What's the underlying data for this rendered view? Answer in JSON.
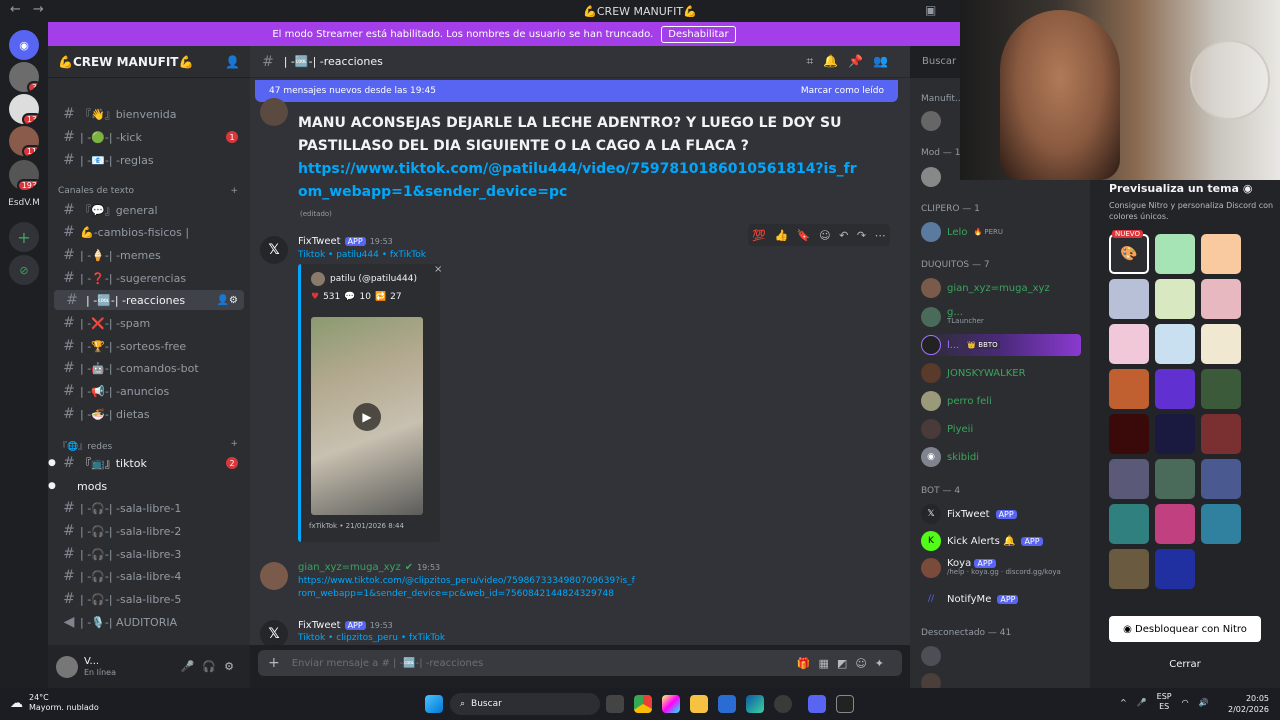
{
  "window": {
    "title": "💪CREW MANUFIT💪"
  },
  "streamer_banner": {
    "text": "El modo Streamer está habilitado. Los nombres de usuario se han truncado.",
    "button": "Deshabilitar"
  },
  "servers": [
    {
      "label": "",
      "badge": "3"
    },
    {
      "label": "",
      "badge": "13"
    },
    {
      "label": "",
      "badge": "11"
    },
    {
      "label": "",
      "badge": "193"
    }
  ],
  "server_name_label": "EsdV.M",
  "guild": {
    "name": "💪CREW MANUFIT💪"
  },
  "sidebar": {
    "top_channels": [
      {
        "label": "『👋』bienvenida",
        "badge": ""
      },
      {
        "label": "| -🟢-| -kick",
        "badge": "1"
      },
      {
        "label": "| -📧-| -reglas",
        "badge": ""
      }
    ],
    "category_text": "Canales de texto",
    "text_channels": [
      {
        "label": "『💬』general",
        "badge": ""
      },
      {
        "label": "💪-cambios-fisicos |",
        "badge": ""
      },
      {
        "label": "| -🍦-| -memes",
        "badge": ""
      },
      {
        "label": "| -❓-| -sugerencias",
        "badge": ""
      },
      {
        "label": "| -🆒-| -reacciones",
        "badge": ""
      },
      {
        "label": "| -❌-| -spam",
        "badge": ""
      },
      {
        "label": "| -🏆-| -sorteos-free",
        "badge": ""
      },
      {
        "label": "| -🤖-| -comandos-bot",
        "badge": ""
      },
      {
        "label": "| -📢-| -anuncios",
        "badge": ""
      },
      {
        "label": "| -🍜-| dietas",
        "badge": ""
      }
    ],
    "category_redes": "『🌐』redes",
    "redes_channels": [
      {
        "label": "『📺』tiktok",
        "badge": "2"
      },
      {
        "label": "mods",
        "badge": ""
      }
    ],
    "voice_channels": [
      {
        "label": "| -🎧-| -sala-libre-1"
      },
      {
        "label": "| -🎧-| -sala-libre-2"
      },
      {
        "label": "| -🎧-| -sala-libre-3"
      },
      {
        "label": "| -🎧-| -sala-libre-4"
      },
      {
        "label": "| -🎧-| -sala-libre-5"
      },
      {
        "label": "| -🎙️-| AUDITORIA"
      }
    ]
  },
  "user": {
    "name": "V...",
    "status": "En línea"
  },
  "channel_header": {
    "name": "| -🆒-| -reacciones"
  },
  "search_placeholder": "Buscar",
  "new_messages": {
    "text": "47 mensajes nuevos desde las 19:45",
    "mark": "Marcar como leído"
  },
  "messages": {
    "m1": {
      "text": "MANU ACONSEJAS DEJARLE LA LECHE ADENTRO?  Y LUEGO LE DOY SU PASTILLASO DEL DIA SIGUIENTE O LA CAGO A LA FLACA ?",
      "link": "https://www.tiktok.com/@patilu444/video/7597810186010561814?is_from_webapp=1&sender_device=pc",
      "edited": "(editado)"
    },
    "m2": {
      "author": "FixTweet",
      "app": "APP",
      "time": "19:53",
      "links": "Tiktok • patilu444 • fxTikTok",
      "embed_user": "patilu (@patilu444)",
      "stats": {
        "likes": "531",
        "comments": "10",
        "shares": "27"
      },
      "footer": "fxTikTok • 21/01/2026 8:44"
    },
    "m3": {
      "author": "gian_xyz=muga_xyz",
      "time": "19:53",
      "link": "https://www.tiktok.com/@clipzitos_peru/video/7598673334980709639?is_from_webapp=1&sender_device=pc&web_id=7560842144824329748"
    },
    "m4": {
      "author": "FixTweet",
      "app": "APP",
      "time": "19:53",
      "links": "Tiktok • clipzitos_peru • fxTikTok"
    }
  },
  "composer": {
    "placeholder": "Enviar mensaje a # | -🆒-| -reacciones"
  },
  "members": {
    "cat_manufit": "Manufit...",
    "cat_mod": "Mod — 1",
    "cat_clipero": "CLIPERO — 1",
    "cat_duquitos": "DUQUITOS — 7",
    "cat_bot": "BOT — 4",
    "cat_offline": "Desconectado — 41",
    "list": [
      {
        "name": "Lelo",
        "tag": "🔥 PERU",
        "color": "#3ba55d"
      },
      {
        "name": "gian_xyz=muga_xyz",
        "tag": "",
        "color": "#3ba55d"
      },
      {
        "name": "g...",
        "tag": "TLauncher",
        "color": "#3ba55d"
      },
      {
        "name": "l...",
        "tag": "👑 BBTO",
        "color": "#a570ff"
      },
      {
        "name": "JONSKYWALKER",
        "tag": "",
        "color": "#3ba55d"
      },
      {
        "name": "perro feli",
        "tag": "",
        "color": "#3ba55d"
      },
      {
        "name": "Piyeii",
        "tag": "",
        "color": "#3ba55d"
      },
      {
        "name": "skibidi",
        "tag": "",
        "color": "#3ba55d"
      }
    ],
    "bots": [
      {
        "name": "FixTweet",
        "app": "APP",
        "sub": ""
      },
      {
        "name": "Kick Alerts 🔔",
        "app": "APP",
        "sub": ""
      },
      {
        "name": "Koya",
        "app": "APP",
        "sub": "/help · koya.gg · discord.gg/koya"
      },
      {
        "name": "NotifyMe",
        "app": "APP",
        "sub": ""
      }
    ]
  },
  "theme_panel": {
    "title": "Previsualiza un tema",
    "desc": "Consigue Nitro y personaliza Discord con colores únicos.",
    "new_tag": "NUEVO",
    "unlock": "Desbloquear con Nitro",
    "close": "Cerrar",
    "swatches": [
      "#2b2d31",
      "#a6e3b5",
      "#f9c9a0",
      "#b8c0d8",
      "#d8e8c0",
      "#e8b8c0",
      "#f0c8d8",
      "#c8e0f0",
      "#f0e8d0",
      "#c06030",
      "#6030d0",
      "#3a5a3a",
      "#3a0a0a",
      "#1a1a40",
      "#7a3030",
      "#5a5a78",
      "#4a6a5a",
      "#4a5a90",
      "#308080",
      "#c04080",
      "#3080a0",
      "#6a5a40",
      "#2030a0"
    ]
  },
  "taskbar": {
    "temp": "24°C",
    "weather": "Mayorm. nublado",
    "search": "Buscar",
    "lang1": "ESP",
    "lang2": "ES",
    "time": "20:05",
    "date": "2/02/2026"
  }
}
